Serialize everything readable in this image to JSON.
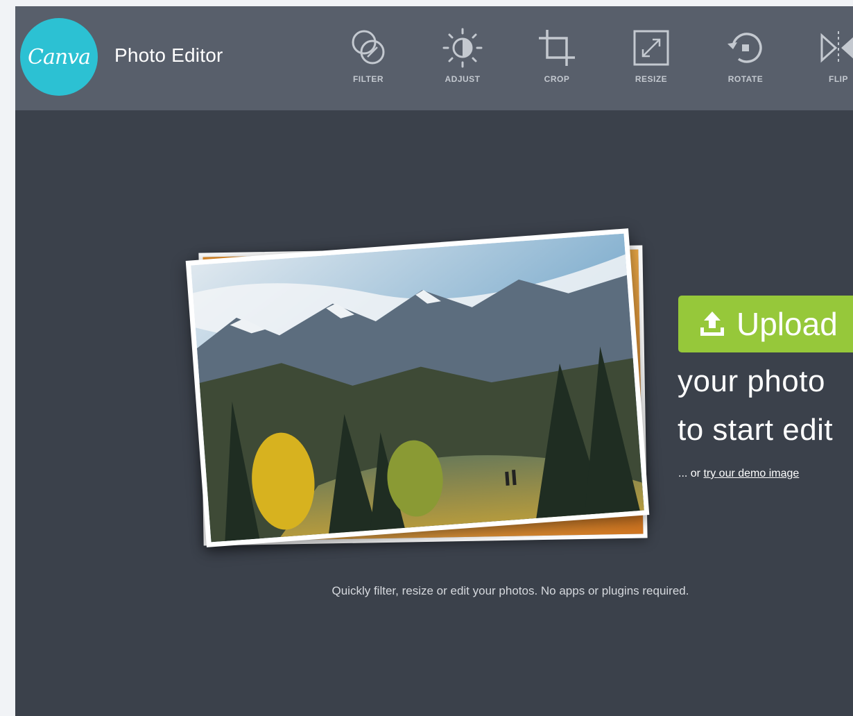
{
  "header": {
    "logo_text": "Canva",
    "app_title": "Photo Editor",
    "tools": [
      {
        "label": "FILTER",
        "icon": "filter-icon"
      },
      {
        "label": "ADJUST",
        "icon": "adjust-icon"
      },
      {
        "label": "CROP",
        "icon": "crop-icon"
      },
      {
        "label": "RESIZE",
        "icon": "resize-icon"
      },
      {
        "label": "ROTATE",
        "icon": "rotate-icon"
      },
      {
        "label": "FLIP",
        "icon": "flip-icon"
      }
    ]
  },
  "main": {
    "upload_label": "Upload",
    "upload_icon": "upload-icon",
    "cta_line1": "your photo",
    "cta_line2": "to start edit",
    "demo_prefix": "... or ",
    "demo_link": "try our demo image",
    "tagline": "Quickly filter, resize or edit your photos. No apps or plugins required.",
    "preview_image": "mountain-landscape-photo"
  },
  "colors": {
    "topbar": "#585f6b",
    "background": "#3b414b",
    "logo": "#2cc1d3",
    "upload_button": "#96c83a"
  }
}
